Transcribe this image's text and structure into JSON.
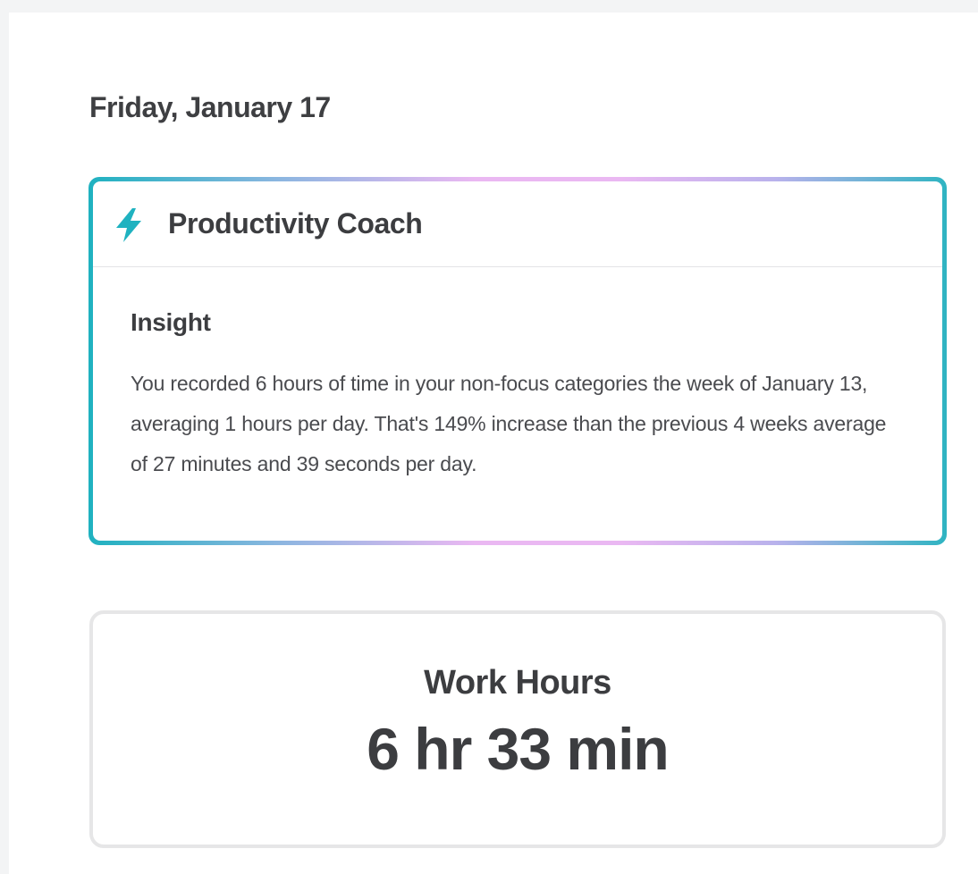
{
  "page": {
    "date_heading": "Friday, January 17"
  },
  "coach": {
    "icon": "lightning-bolt-icon",
    "title": "Productivity Coach",
    "insight_title": "Insight",
    "insight_text": "You recorded 6 hours of time in your non-focus categories the week of January 13, averaging 1 hours per day. That's 149% increase than the previous 4 weeks average of 27 minutes and 39 seconds per day."
  },
  "work_hours": {
    "label": "Work Hours",
    "value": "6 hr 33 min"
  },
  "colors": {
    "page_background": "#f3f4f5",
    "accent_teal": "#1fb2c0",
    "accent_pink": "#eab8f2",
    "text": "#3c3d40",
    "card_border": "#e6e6e7"
  }
}
